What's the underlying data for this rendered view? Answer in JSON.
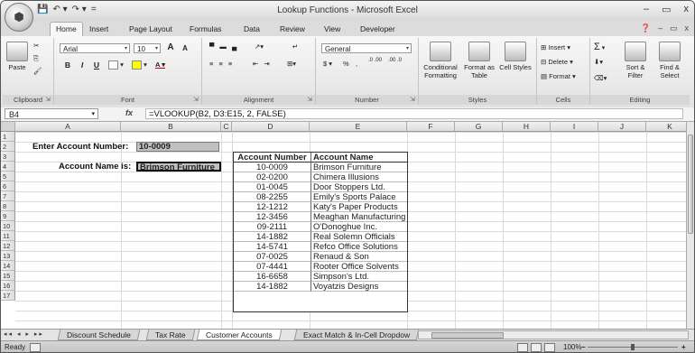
{
  "title": "Lookup Functions - Microsoft Excel",
  "qat": [
    "💾",
    "↶ ▾",
    "↷ ▾",
    "="
  ],
  "window_controls": [
    "–",
    "▭",
    "x"
  ],
  "tabs": [
    "Home",
    "Insert",
    "Page Layout",
    "Formulas",
    "Data",
    "Review",
    "View",
    "Developer"
  ],
  "tabs_right": [
    "❓",
    "–",
    "▭",
    "x"
  ],
  "ribbon": {
    "clipboard": {
      "paste": "Paste",
      "label": "Clipboard"
    },
    "font": {
      "name": "Arial",
      "size": "10",
      "grow": "A",
      "shrink": "A",
      "bold": "B",
      "italic": "I",
      "underline": "U",
      "label": "Font"
    },
    "alignment": {
      "label": "Alignment"
    },
    "number": {
      "format": "General",
      "currency": "$",
      "percent": "%",
      "comma": ",",
      "inc_dec": ".0 .00",
      "dec_dec": ".00 .0",
      "label": "Number"
    },
    "styles": {
      "conditional": "Conditional Formatting",
      "format_table": "Format as Table",
      "cell_styles": "Cell Styles",
      "label": "Styles"
    },
    "cells": {
      "insert": "Insert",
      "delete": "Delete",
      "format": "Format",
      "label": "Cells"
    },
    "editing": {
      "sum": "Σ",
      "sort": "Sort & Filter",
      "find": "Find & Select",
      "label": "Editing"
    }
  },
  "formula_bar": {
    "name_box": "B4",
    "fx": "fx",
    "formula": "=VLOOKUP(B2, D3:E15, 2, FALSE)"
  },
  "columns": [
    "A",
    "B",
    "C",
    "D",
    "E",
    "F",
    "G",
    "H",
    "I",
    "J",
    "K"
  ],
  "rows": [
    "1",
    "2",
    "3",
    "4",
    "5",
    "6",
    "7",
    "8",
    "9",
    "10",
    "11",
    "12",
    "13",
    "14",
    "15",
    "16",
    "17"
  ],
  "sheet": {
    "enter_label": "Enter Account Number:",
    "enter_value": "10-0009",
    "name_label": "Account Name is:",
    "name_value": "Brimson Furniture",
    "table_headers": [
      "Account Number",
      "Account Name"
    ],
    "table_rows": [
      [
        "10-0009",
        "Brimson Furniture"
      ],
      [
        "02-0200",
        "Chimera Illusions"
      ],
      [
        "01-0045",
        "Door Stoppers Ltd."
      ],
      [
        "08-2255",
        "Emily's Sports Palace"
      ],
      [
        "12-1212",
        "Katy's Paper Products"
      ],
      [
        "12-3456",
        "Meaghan Manufacturing"
      ],
      [
        "09-2111",
        "O'Donoghue Inc."
      ],
      [
        "14-1882",
        "Real Solemn Officials"
      ],
      [
        "14-5741",
        "Refco Office Solutions"
      ],
      [
        "07-0025",
        "Renaud & Son"
      ],
      [
        "07-4441",
        "Rooter Office Solvents"
      ],
      [
        "16-6658",
        "Simpson's Ltd."
      ],
      [
        "14-1882",
        "Voyatzis Designs"
      ]
    ]
  },
  "sheet_tabs": [
    "Discount Schedule",
    "Tax Rate",
    "Customer Accounts",
    "Exact Match & In-Cell Dropdow"
  ],
  "active_sheet": "Customer Accounts",
  "nav_buttons": "◂◂ ◂ ▸ ▸▸",
  "status": {
    "ready": "Ready",
    "zoom": "100%",
    "minus": "−",
    "plus": "+"
  }
}
